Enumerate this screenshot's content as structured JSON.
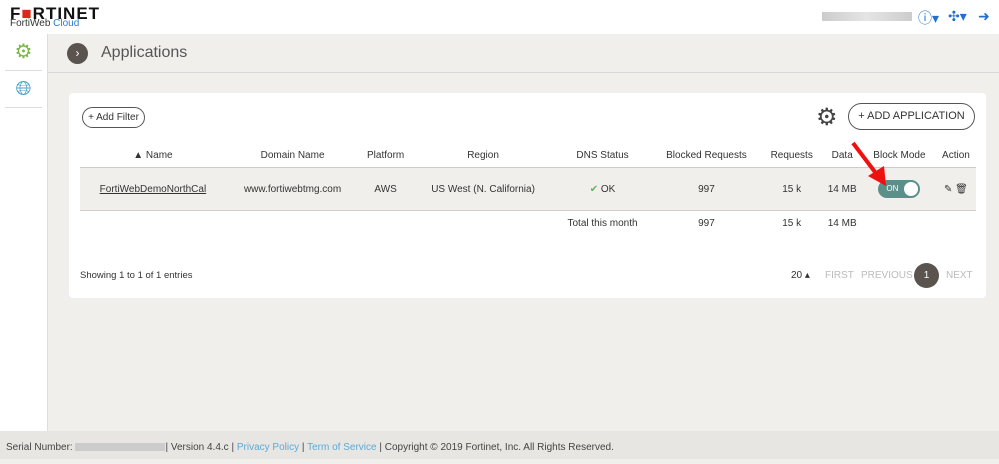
{
  "brand": {
    "logo": "FORTINET",
    "product": "FortiWeb",
    "product_accent": "Cloud"
  },
  "header": {
    "title": "Applications"
  },
  "toolbar": {
    "add_filter": "+ Add Filter",
    "add_application": "+ ADD APPLICATION"
  },
  "table": {
    "columns": [
      "▲ Name",
      "Domain Name",
      "Platform",
      "Region",
      "DNS Status",
      "Blocked Requests",
      "Requests",
      "Data",
      "Block Mode",
      "Action"
    ],
    "rows": [
      {
        "name": "FortiWebDemoNorthCal",
        "domain": "www.fortiwebtmg.com",
        "platform": "AWS",
        "region": "US West (N. California)",
        "dns": "OK",
        "blocked": "997",
        "requests": "15 k",
        "data": "14 MB",
        "block_mode": "ON"
      }
    ],
    "total": {
      "label": "Total this month",
      "blocked": "997",
      "requests": "15 k",
      "data": "14 MB"
    }
  },
  "pagination": {
    "summary": "Showing 1 to 1 of 1 entries",
    "page_size": "20 ▴",
    "first": "FIRST",
    "previous": "PREVIOUS",
    "current": "1",
    "next": "NEXT"
  },
  "footer": {
    "serial_label": "Serial Number:",
    "version": "| Version 4.4.c |",
    "privacy": "Privacy Policy",
    "sep": "|",
    "terms": "Term of Service",
    "copyright": "| Copyright © 2019 Fortinet, Inc. All Rights Reserved."
  }
}
